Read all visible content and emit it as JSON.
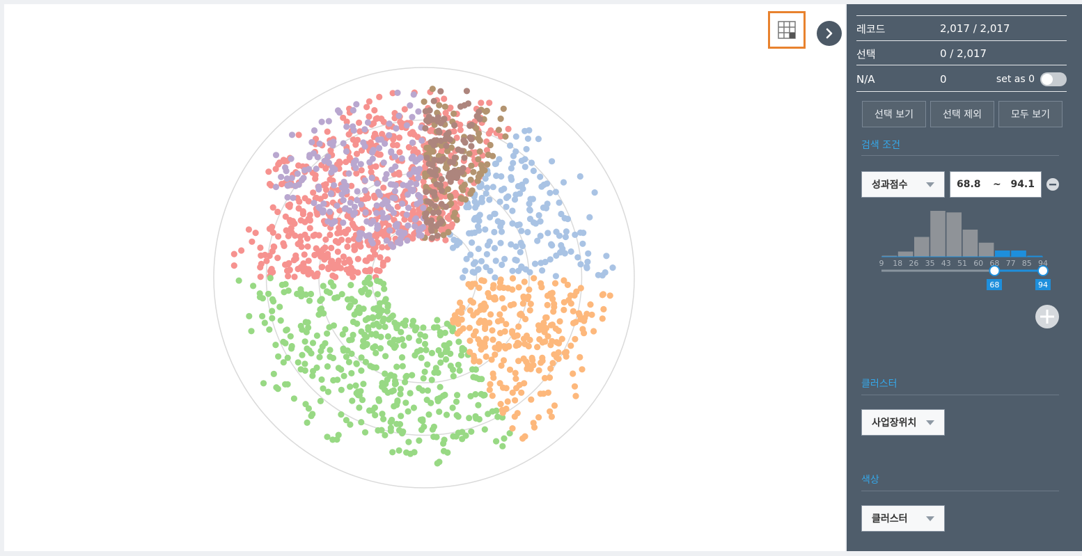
{
  "chart_data": {
    "type": "scatter",
    "subtype": "polar-cluster-scatter",
    "total_points": 2017,
    "rings": 4,
    "clusters": [
      {
        "color": "#f6928f",
        "angle_range_deg": [
          180,
          300
        ],
        "points_shown": 640
      },
      {
        "color": "#98d984",
        "angle_range_deg": [
          60,
          180
        ],
        "points_shown": 420
      },
      {
        "color": "#fdb87c",
        "angle_range_deg": [
          0,
          60
        ],
        "points_shown": 260
      },
      {
        "color": "#a9c3e4",
        "angle_range_deg": [
          300,
          360
        ],
        "points_shown": 190
      },
      {
        "color": "#b39470",
        "angle_range_deg": [
          270,
          300
        ],
        "points_shown": 120
      },
      {
        "color": "#b9a7cf",
        "angle_range_deg": [
          210,
          270
        ],
        "points_shown": 220
      },
      {
        "color": "#ad857d",
        "angle_range_deg": [
          270,
          290
        ],
        "points_shown": 100
      }
    ],
    "grid": true,
    "legend": "none"
  },
  "toolbar": {
    "table_icon": "table-grid-icon",
    "collapse_icon": "chevron-right-icon"
  },
  "panel": {
    "records_label": "레코드",
    "records_value": "2,017 / 2,017",
    "selected_label": "선택",
    "selected_value": "0 / 2,017",
    "na_label": "N/A",
    "na_value": "0",
    "set_as_zero_label": "set as 0",
    "buttons": {
      "show_selected": "선택 보기",
      "exclude_selected": "선택 제외",
      "show_all": "모두 보기"
    },
    "search_title": "검색 조건",
    "filter_field": "성과점수",
    "range_min": "68.8",
    "range_sep": "~",
    "range_max": "94.1",
    "histogram": {
      "ticks": [
        "9",
        "18",
        "26",
        "35",
        "43",
        "51",
        "60",
        "68",
        "77",
        "85",
        "94"
      ],
      "values": [
        2,
        10,
        38,
        88,
        85,
        52,
        27,
        12,
        12,
        2
      ],
      "selected_from_bin": 7,
      "bar_color": "#8f9398",
      "selected_color": "#1e8fdc"
    },
    "slider_low": "68",
    "slider_high": "94",
    "cluster_title": "클러스터",
    "cluster_select": "사업장위치",
    "color_title": "색상",
    "color_select": "클러스터"
  }
}
